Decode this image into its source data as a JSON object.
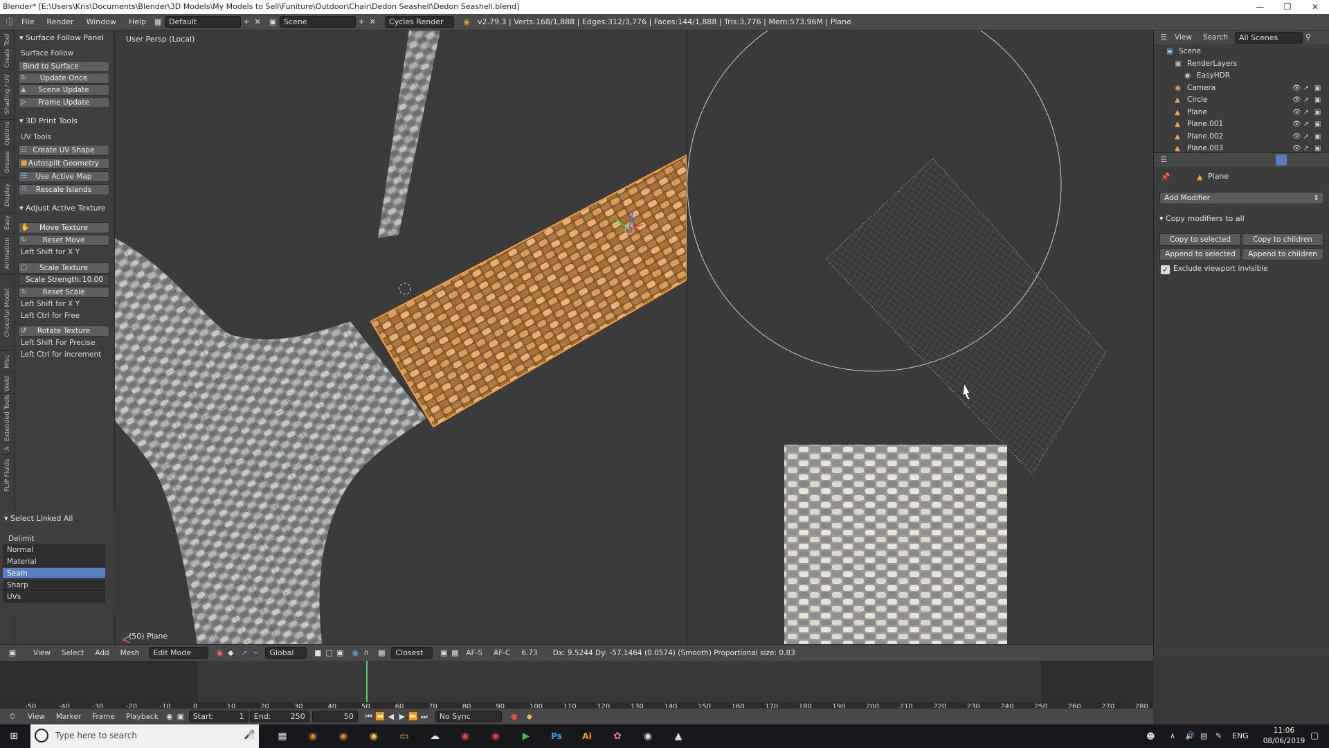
{
  "titlebar": {
    "title": "Blender* [E:\\Users\\Kris\\Documents\\Blender\\3D Models\\My Models to Sell\\Funiture\\Outdoor\\Chair\\Dedon Seashell\\Dedon Seashell.blend]"
  },
  "menubar": {
    "menus": [
      "File",
      "Render",
      "Window",
      "Help"
    ],
    "layout": "Default",
    "scene": "Scene",
    "engine": "Cycles Render",
    "stats": "v2.79.3 | Verts:168/1,888 | Edges:312/3,776 | Faces:144/1,888 | Tris:3,776 | Mem:573.96M | Plane"
  },
  "tool_tabs": [
    "Tool",
    "Create",
    "Shading / UV",
    "Options",
    "Grease Pencil",
    "Display",
    "Easy HDR",
    "Animation",
    "Chocofur Model Manager",
    "Misc",
    "Weld",
    "Extended Tools",
    "A",
    "FLIP Fluids"
  ],
  "toolshelf": {
    "surface_follow": {
      "header": "Surface Follow Panel",
      "label": "Surface Follow",
      "buttons": [
        "Bind to Surface",
        "Update Once",
        "Scene Update",
        "Frame Update"
      ]
    },
    "print3d": {
      "header": "3D Print Tools",
      "label": "UV Tools",
      "buttons": [
        "Create UV Shape",
        "Autosplit Geometry",
        "Use Active Map",
        "Rescale Islands"
      ]
    },
    "adjust": {
      "header": "Adjust Active Texture",
      "move": "Move Texture",
      "reset_move": "Reset Move",
      "hint1": "Left Shift for X Y",
      "scale": "Scale Texture",
      "strength_label": "Scale Strength:",
      "strength_value": "10.00",
      "reset_scale": "Reset Scale",
      "hint2": "Left Shift for X Y",
      "hint3": "Left Ctrl for Free",
      "rotate": "Rotate Texture",
      "hint4": "Left Shift For Precise",
      "hint5": "Left Ctrl for increment"
    },
    "select_linked": {
      "header": "Select Linked All",
      "delimit": "Delimit",
      "items": [
        "Normal",
        "Material",
        "Seam",
        "Sharp",
        "UVs"
      ],
      "selected": "Seam"
    }
  },
  "viewport": {
    "persp": "User Persp (Local)",
    "object": "(50) Plane"
  },
  "outliner": {
    "view": "View",
    "search": "Search",
    "filter": "All Scenes",
    "items": [
      "Scene",
      "RenderLayers",
      "EasyHDR",
      "Camera",
      "Circle",
      "Plane",
      "Plane.001",
      "Plane.002",
      "Plane.003"
    ]
  },
  "properties": {
    "object": "Plane",
    "add_modifier": "Add Modifier",
    "panel": "Copy modifiers to all",
    "copy_selected": "Copy to selected",
    "copy_children": "Copy to children",
    "append_selected": "Append to selected",
    "append_children": "Append to children",
    "exclude": "Exclude viewport invisible"
  },
  "view_header": {
    "menus": [
      "View",
      "Select",
      "Add",
      "Mesh"
    ],
    "mode": "Edit Mode",
    "orientation": "Global",
    "snap": "Closest",
    "afs": "AF-S",
    "afc": "AF-C",
    "value": "6.73",
    "status": "Dx: 9.5244  Dy: -57.1464 (0.0574) (Smooth) Proportional size: 0.83"
  },
  "timeline": {
    "ticks": [
      "-50",
      "-40",
      "-30",
      "-20",
      "-10",
      "0",
      "10",
      "20",
      "30",
      "40",
      "50",
      "60",
      "70",
      "80",
      "90",
      "100",
      "110",
      "120",
      "130",
      "140",
      "150",
      "160",
      "170",
      "180",
      "190",
      "200",
      "210",
      "220",
      "230",
      "240",
      "250",
      "260",
      "270",
      "280"
    ],
    "current": 50,
    "menus": [
      "View",
      "Marker",
      "Frame",
      "Playback"
    ],
    "start": "Start:",
    "start_val": "1",
    "end": "End:",
    "end_val": "250",
    "frame": "50",
    "sync": "No Sync"
  },
  "taskbar": {
    "search": "Type here to search",
    "lang": "ENG",
    "time": "11:06",
    "date": "08/06/2019"
  }
}
